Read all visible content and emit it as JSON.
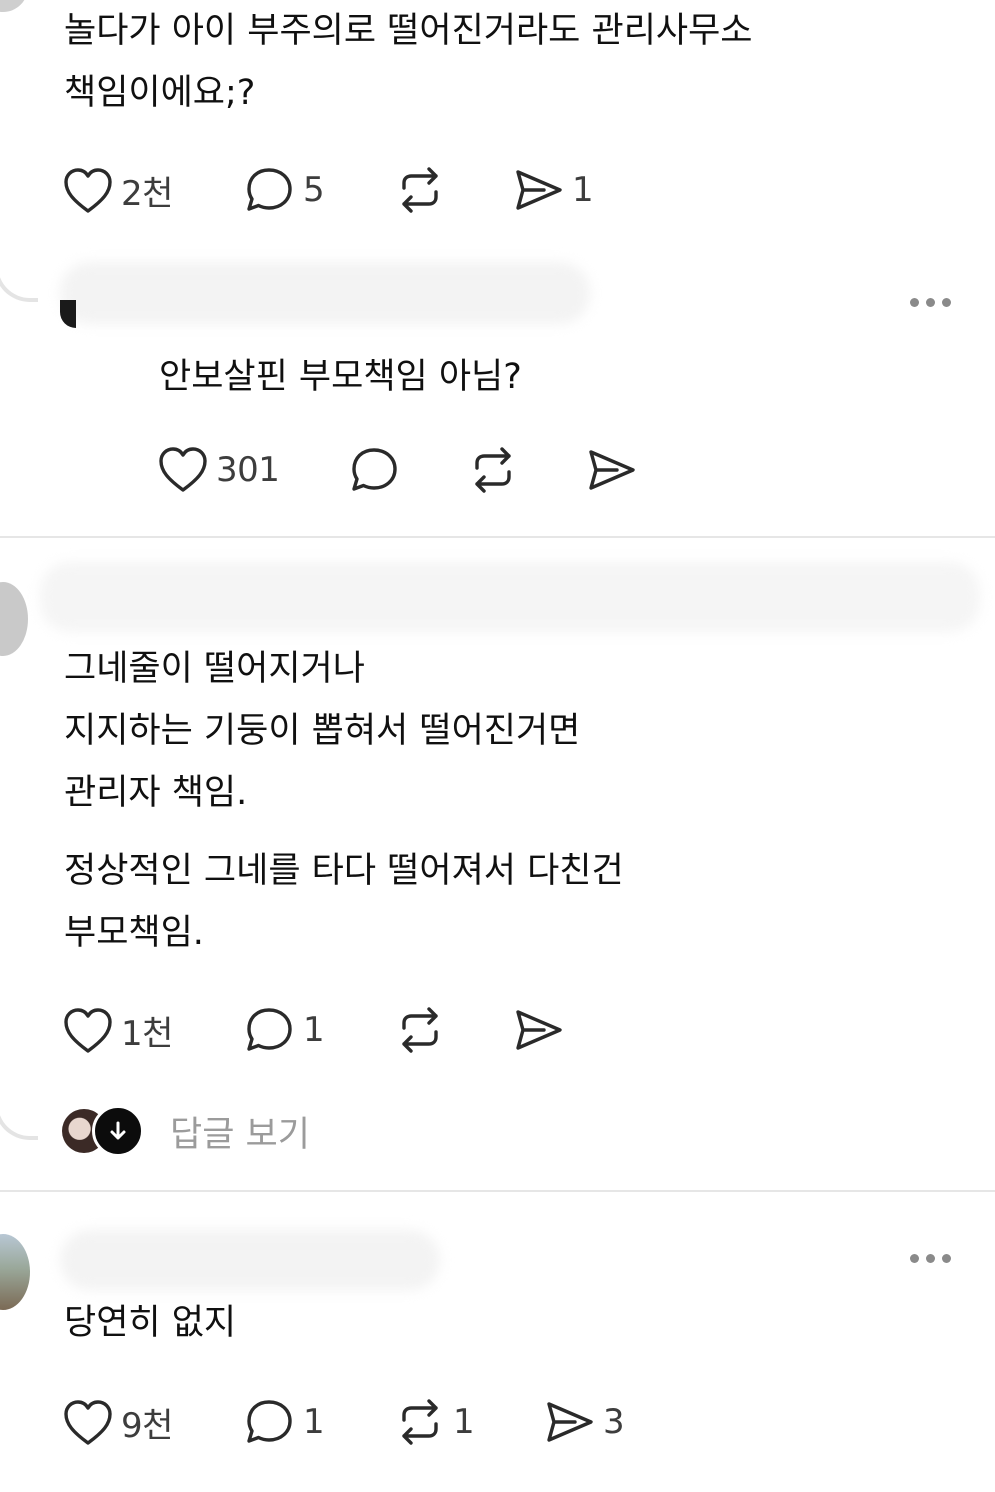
{
  "post1": {
    "lines": [
      "놀다가 아이 부주의로 떨어진거라도 관리사무소",
      "책임이에요;?"
    ],
    "actions": {
      "like_count": "2천",
      "comment_count": "5",
      "repost_count": "",
      "share_count": "1"
    }
  },
  "reply1": {
    "lines": [
      "안보살핀 부모책임 아님?"
    ],
    "actions": {
      "like_count": "301",
      "comment_count": "",
      "repost_count": "",
      "share_count": ""
    }
  },
  "post2": {
    "paragraph1": [
      "그네줄이 떨어지거나",
      "지지하는 기둥이 뽑혀서 떨어진거면",
      "관리자 책임."
    ],
    "paragraph2": [
      "정상적인 그네를 타다 떨어져서 다친건",
      "부모책임."
    ],
    "actions": {
      "like_count": "1천",
      "comment_count": "1",
      "repost_count": "",
      "share_count": ""
    },
    "view_replies_label": "답글 보기"
  },
  "post3": {
    "lines": [
      "당연히 없지"
    ],
    "actions": {
      "like_count": "9천",
      "comment_count": "1",
      "repost_count": "1",
      "share_count": "3"
    }
  },
  "icons": {
    "like": "heart-icon",
    "comment": "comment-bubble-icon",
    "repost": "repost-icon",
    "share": "send-icon",
    "more": "more-dots-icon",
    "expand": "arrow-down-icon"
  },
  "colors": {
    "text": "#101010",
    "secondary": "#3d3d3d",
    "muted": "#9b9b9b",
    "divider": "#e6e6e6"
  }
}
